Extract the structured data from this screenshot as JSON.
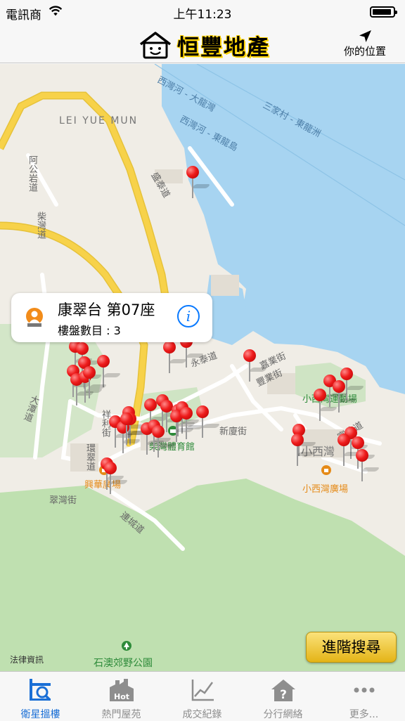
{
  "status_bar": {
    "carrier": "電訊商",
    "time": "上午11:23"
  },
  "nav": {
    "brand": "恒豐地產",
    "locate_label": "你的位置"
  },
  "map": {
    "labels": [
      {
        "key": "lei_yue_mun",
        "text": "LEI YUE MUN"
      },
      {
        "key": "sai_wan_ho_tai",
        "text": "西灣河 - 大龍灣"
      },
      {
        "key": "sam_ka_tsuen",
        "text": "三家村 - 東龍洲"
      },
      {
        "key": "sai_wan_ho_tung",
        "text": "西灣河 - 東龍島"
      },
      {
        "key": "kon_yan_rd",
        "text": "阿公岩道"
      },
      {
        "key": "chai_wan_rd",
        "text": "柴灣道"
      },
      {
        "key": "sheng_tai_st",
        "text": "盛泰道"
      },
      {
        "key": "tai_tam_rd",
        "text": "大潭道"
      },
      {
        "key": "wing_tai_rd",
        "text": "永泰道"
      },
      {
        "key": "ka_yip_st",
        "text": "嘉業街"
      },
      {
        "key": "fung_yip_st",
        "text": "豐業街"
      },
      {
        "key": "sun_ha_st",
        "text": "新廈街"
      },
      {
        "key": "siu_sai_wan_sports",
        "text": "小西灣運動場"
      },
      {
        "key": "siu_sai_wan",
        "text": "小西灣"
      },
      {
        "key": "fu_yan_st",
        "text": "富欣道"
      },
      {
        "key": "chai_wan_sports",
        "text": "柴灣體育館"
      },
      {
        "key": "hing_wah_plaza",
        "text": "興華廣場"
      },
      {
        "key": "siu_sai_wan_plaza",
        "text": "小西灣廣場"
      },
      {
        "key": "tsui_wan_st",
        "text": "翠灣街"
      },
      {
        "key": "lin_shing_rd",
        "text": "連城道"
      },
      {
        "key": "shek_o_park",
        "text": "石澳郊野公園"
      },
      {
        "key": "cheung_lee_st",
        "text": "祥利街"
      },
      {
        "key": "wan_tsui_rd",
        "text": "環翠道"
      }
    ]
  },
  "callout": {
    "title": "康翠台 第07座",
    "subtitle": "樓盤數目 : 3"
  },
  "advanced_search": "進階搜尋",
  "legal_label": "法律資訊",
  "tabs": [
    {
      "label": "衛星搵樓",
      "icon": "map-search-icon",
      "active": true
    },
    {
      "label": "熱門屋苑",
      "icon": "hot-buildings-icon",
      "active": false
    },
    {
      "label": "成交紀錄",
      "icon": "line-chart-icon",
      "active": false
    },
    {
      "label": "分行網絡",
      "icon": "branch-house-icon",
      "active": false
    },
    {
      "label": "更多...",
      "icon": "more-dots-icon",
      "active": false
    }
  ],
  "colors": {
    "active_tab": "#1a6fd6",
    "inactive_tab": "#8e8e8e",
    "sea": "#a7d4f1",
    "park": "#bfe0b0",
    "road_major": "#f7d24a",
    "pin": "#ee1c1c",
    "search_button": "#f2ca3a"
  }
}
